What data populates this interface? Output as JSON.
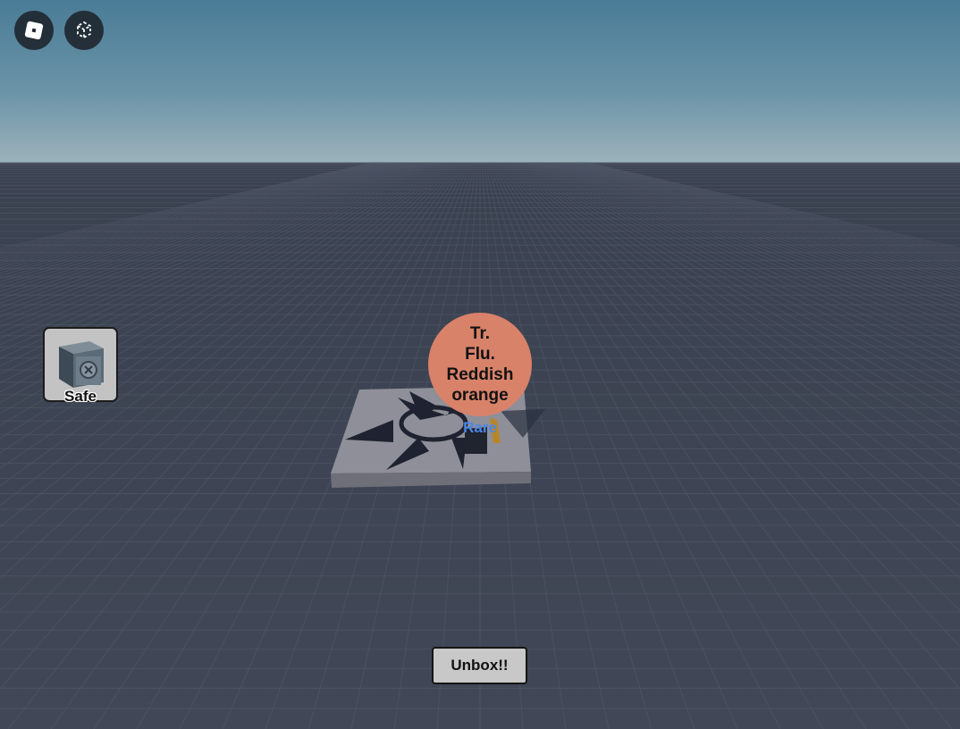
{
  "topbar": {
    "roblox_menu_icon": "roblox-logo-icon",
    "camera_icon": "camera-select-icon"
  },
  "inventory": {
    "safe_label": "Safe",
    "safe_icon": "safe-icon"
  },
  "item_display": {
    "name_lines": [
      "Tr.",
      "Flu.",
      "Reddish",
      "orange"
    ],
    "rarity": "Rare",
    "bubble_color": "#d8826a",
    "rarity_color": "#4b86e6"
  },
  "actions": {
    "unbox_label": "Unbox!!"
  },
  "colors": {
    "sky_top": "#4a7c97",
    "baseplate": "#3e4452",
    "button_bg": "#c8c8c8"
  }
}
